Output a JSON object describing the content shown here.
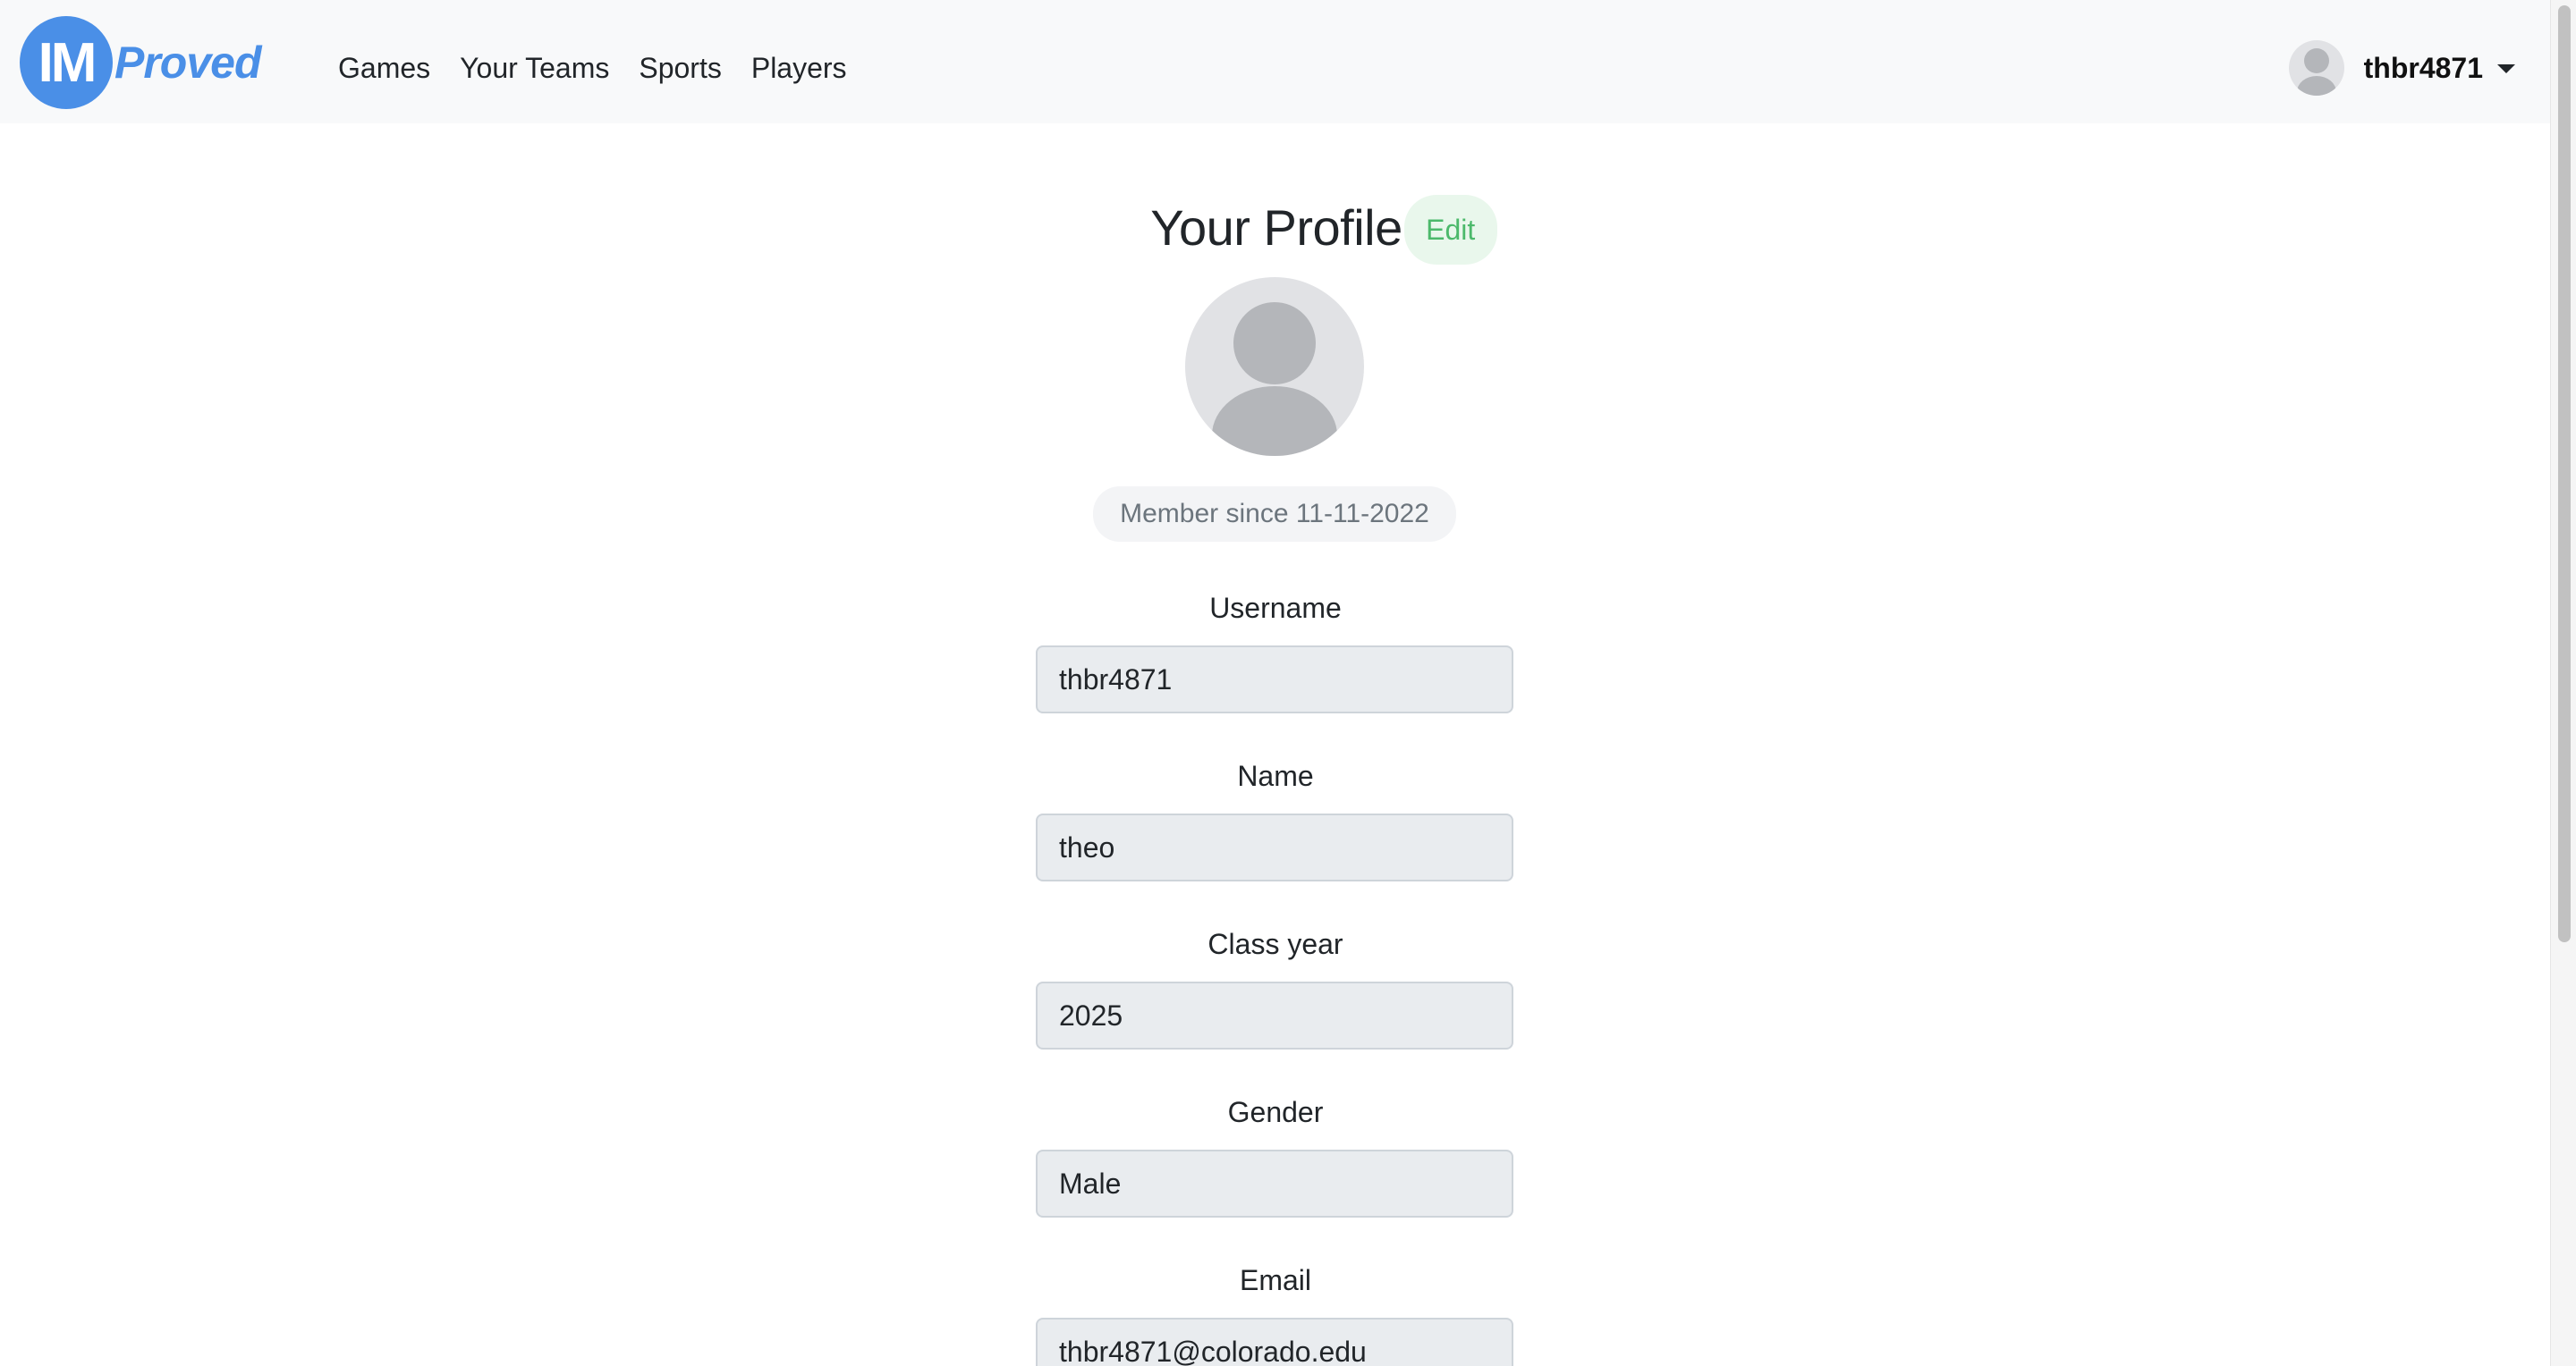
{
  "navbar": {
    "brand": {
      "mark": "IM",
      "text": "Proved"
    },
    "links": [
      "Games",
      "Your Teams",
      "Sports",
      "Players"
    ],
    "user": {
      "username": "thbr4871"
    }
  },
  "profile": {
    "title": "Your Profile",
    "edit_label": "Edit",
    "member_since": "Member since 11-11-2022",
    "fields": [
      {
        "label": "Username",
        "value": "thbr4871"
      },
      {
        "label": "Name",
        "value": "theo"
      },
      {
        "label": "Class year",
        "value": "2025"
      },
      {
        "label": "Gender",
        "value": "Male"
      },
      {
        "label": "Email",
        "value": "thbr4871@colorado.edu"
      }
    ]
  },
  "colors": {
    "brand": "#4a8fe7",
    "edit_green": "#4cb96b",
    "navbar_bg": "#f8f9fa",
    "input_bg": "#e9ecef"
  }
}
